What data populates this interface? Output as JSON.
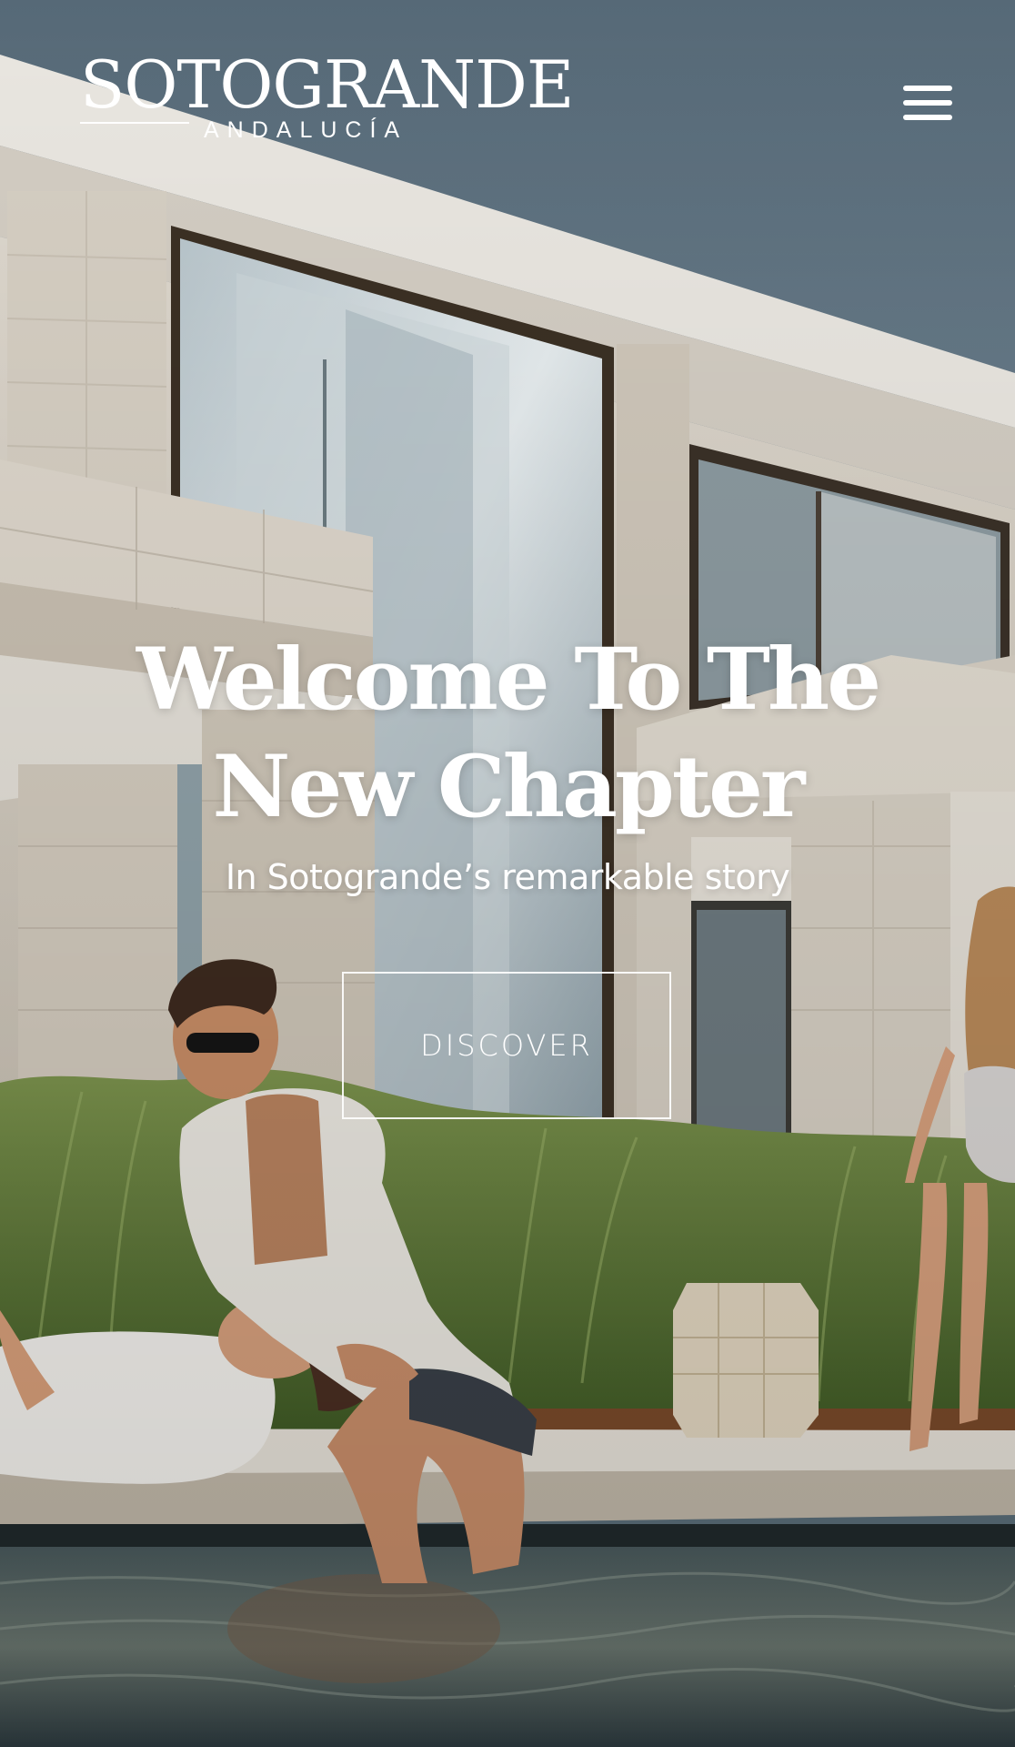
{
  "header": {
    "logo_main": "SOTOGRANDE",
    "logo_sub": "ANDALUCÍA",
    "menu_icon": "hamburger-menu-icon"
  },
  "hero": {
    "title_line1": "Welcome To The",
    "title_line2": "New Chapter",
    "subtitle": "In Sotogrande’s remarkable story",
    "cta_label": "DISCOVER"
  },
  "colors": {
    "sky": "#5b6e7a",
    "stone": "#d8d2c8",
    "grass": "#5f7a3a",
    "water": "#2e3e45",
    "text": "#ffffff"
  }
}
